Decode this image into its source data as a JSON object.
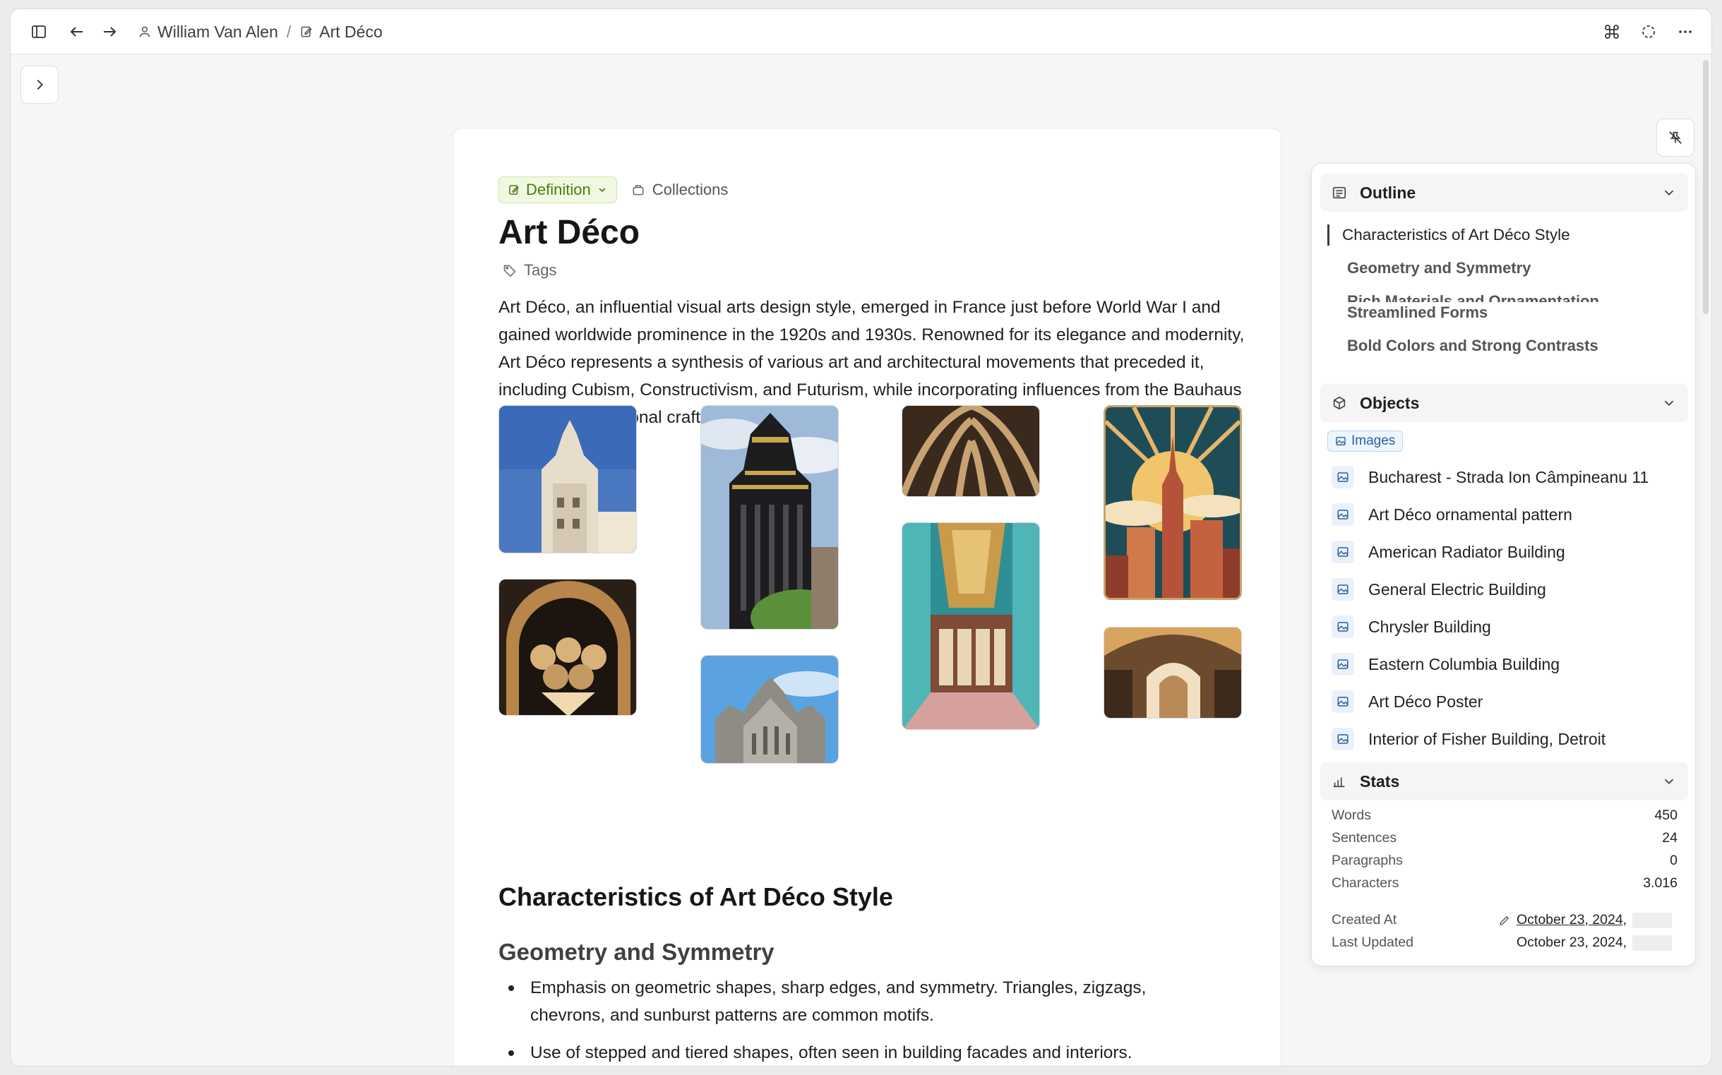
{
  "breadcrumb": {
    "owner": "William Van Alen",
    "separator": "/",
    "page": "Art Déco"
  },
  "document": {
    "type_chip": "Definition",
    "collections_label": "Collections",
    "title": "Art Déco",
    "tags_label": "Tags",
    "intro": "Art Déco, an influential visual arts design style, emerged in France just before World War I and gained worldwide prominence in the 1920s and 1930s. Renowned for its elegance and modernity, Art Déco represents a synthesis of various art and architectural movements that preceded it, including Cubism, Constructivism, and Futurism, while incorporating influences from the Bauhaus school and traditional crafts.",
    "h2": "Characteristics of Art Déco Style",
    "h3": "Geometry and Symmetry",
    "bullets": [
      "Emphasis on geometric shapes, sharp edges, and symmetry. Triangles, zigzags, chevrons, and sunburst patterns are common motifs.",
      "Use of stepped and tiered shapes, often seen in building facades and interiors."
    ]
  },
  "panel": {
    "outline": {
      "title": "Outline",
      "items": [
        "Characteristics of Art Déco Style",
        "Geometry and Symmetry",
        "Rich Materials and Ornamentation",
        "Streamlined Forms",
        "Bold Colors and Strong Contrasts"
      ]
    },
    "objects": {
      "title": "Objects",
      "filter": "Images",
      "items": [
        "Bucharest - Strada Ion Câmpineanu 11",
        "Art Déco ornamental pattern",
        "American Radiator Building",
        "General Electric Building",
        "Chrysler Building",
        "Eastern Columbia Building",
        "Art Déco Poster",
        "Interior of Fisher Building, Detroit"
      ]
    },
    "stats": {
      "title": "Stats",
      "words_label": "Words",
      "words": "450",
      "sentences_label": "Sentences",
      "sentences": "24",
      "paragraphs_label": "Paragraphs",
      "paragraphs": "0",
      "characters_label": "Characters",
      "characters": "3.016",
      "created_label": "Created At",
      "created": "October 23, 2024,",
      "updated_label": "Last Updated",
      "updated": "October 23, 2024,"
    }
  },
  "colors": {
    "accent_green": "#4e7a11",
    "accent_blue": "#2a5f9e"
  }
}
